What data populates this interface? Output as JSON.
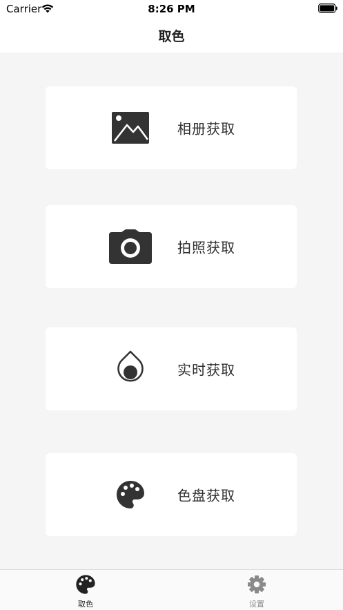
{
  "status_bar": {
    "carrier": "Carrier",
    "time": "8:26 PM"
  },
  "nav": {
    "title": "取色"
  },
  "cards": [
    {
      "label": "相册获取",
      "icon": "photo-album-icon"
    },
    {
      "label": "拍照获取",
      "icon": "camera-icon"
    },
    {
      "label": "实时获取",
      "icon": "realtime-drop-icon"
    },
    {
      "label": "色盘获取",
      "icon": "palette-icon"
    }
  ],
  "tabs": [
    {
      "label": "取色",
      "icon": "palette-icon",
      "active": true
    },
    {
      "label": "设置",
      "icon": "gear-icon",
      "active": false
    }
  ],
  "colors": {
    "background": "#f5f5f5",
    "card": "#ffffff",
    "icon": "#333333",
    "tab_active": "#222222",
    "tab_inactive": "#8a8a8a"
  }
}
